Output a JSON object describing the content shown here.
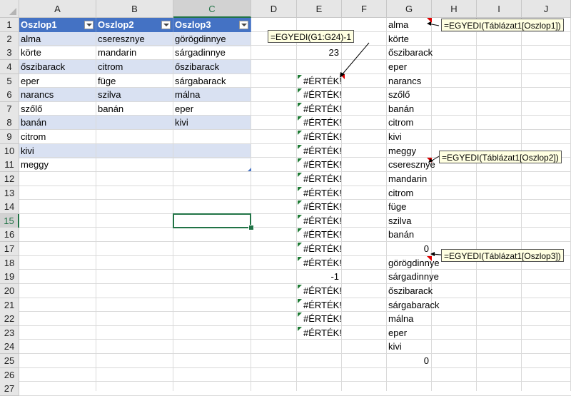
{
  "columns": [
    "A",
    "B",
    "C",
    "D",
    "E",
    "F",
    "G",
    "H",
    "I",
    "J"
  ],
  "rows": [
    "1",
    "2",
    "3",
    "4",
    "5",
    "6",
    "7",
    "8",
    "9",
    "10",
    "11",
    "12",
    "13",
    "14",
    "15",
    "16",
    "17",
    "18",
    "19",
    "20",
    "21",
    "22",
    "23",
    "24",
    "25",
    "26",
    "27"
  ],
  "table": {
    "headers": [
      "Oszlop1",
      "Oszlop2",
      "Oszlop3"
    ],
    "rows": [
      [
        "alma",
        "cseresznye",
        "görögdinnye"
      ],
      [
        "körte",
        "mandarin",
        "sárgadinnye"
      ],
      [
        "őszibarack",
        "citrom",
        "őszibarack"
      ],
      [
        "eper",
        "füge",
        "sárgabarack"
      ],
      [
        "narancs",
        "szilva",
        "málna"
      ],
      [
        "szőlő",
        "banán",
        "eper"
      ],
      [
        "banán",
        "",
        "kivi"
      ],
      [
        "citrom",
        "",
        ""
      ],
      [
        "kivi",
        "",
        ""
      ],
      [
        "meggy",
        "",
        ""
      ]
    ]
  },
  "column_e": [
    "",
    "",
    "23",
    "",
    "#ÉRTÉK!",
    "#ÉRTÉK!",
    "#ÉRTÉK!",
    "#ÉRTÉK!",
    "#ÉRTÉK!",
    "#ÉRTÉK!",
    "#ÉRTÉK!",
    "#ÉRTÉK!",
    "#ÉRTÉK!",
    "#ÉRTÉK!",
    "#ÉRTÉK!",
    "#ÉRTÉK!",
    "#ÉRTÉK!",
    "#ÉRTÉK!",
    "-1",
    "#ÉRTÉK!",
    "#ÉRTÉK!",
    "#ÉRTÉK!",
    "#ÉRTÉK!",
    "",
    "",
    "",
    ""
  ],
  "column_g": [
    "alma",
    "körte",
    "őszibarack",
    "eper",
    "narancs",
    "szőlő",
    "banán",
    "citrom",
    "kivi",
    "meggy",
    "cseresznye",
    "mandarin",
    "citrom",
    "füge",
    "szilva",
    "banán",
    "0",
    "görögdinnye",
    "sárgadinnye",
    "őszibarack",
    "sárgabarack",
    "málna",
    "eper",
    "kivi",
    "0",
    "",
    ""
  ],
  "notes": {
    "e_formula": "=EGYEDI(G1:G24)-1",
    "g1_formula": "=EGYEDI(Táblázat1[Oszlop1])",
    "g11_formula": "=EGYEDI(Táblázat1[Oszlop2])",
    "g18_formula": "=EGYEDI(Táblázat1[Oszlop3])"
  },
  "selected_cell": "C15",
  "colors": {
    "table_header": "#4472c4",
    "band": "#d9e1f2",
    "error_marker": "#1e7b34",
    "comment_marker": "#e00000",
    "selection": "#217346"
  }
}
